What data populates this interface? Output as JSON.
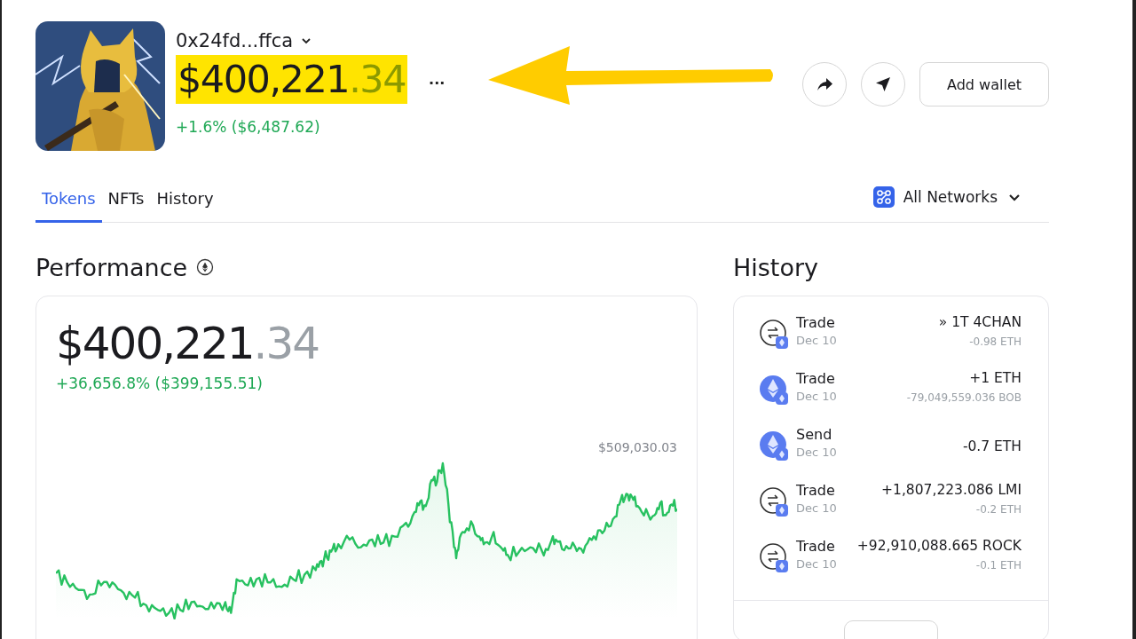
{
  "wallet": {
    "address": "0x24fd...ffca",
    "balance": "$400,221",
    "balance_cents": ".34",
    "highlighted": true,
    "more": "...",
    "change": "+1.6% ($6,487.62)"
  },
  "actions": {
    "add_wallet": "Add wallet"
  },
  "tabs": [
    {
      "label": "Tokens",
      "selected": true
    },
    {
      "label": "NFTs",
      "selected": false
    },
    {
      "label": "History",
      "selected": false
    }
  ],
  "network_filter": {
    "label": "All Networks"
  },
  "performance": {
    "title": "Performance",
    "balance": "$400,221",
    "balance_cents": ".34",
    "change": "+36,656.8% ($399,155.51)",
    "max_label": "$509,030.03"
  },
  "history": {
    "title": "History",
    "items": [
      {
        "kind": "swap",
        "title": "Trade",
        "date": "Dec 10",
        "amount": "» 1T 4CHAN",
        "sub_amount": "-0.98 ETH"
      },
      {
        "kind": "eth",
        "title": "Trade",
        "date": "Dec 10",
        "amount": "+1 ETH",
        "sub_amount": "-79,049,559.036 BOB"
      },
      {
        "kind": "eth",
        "title": "Send",
        "date": "Dec 10",
        "amount": "-0.7 ETH"
      },
      {
        "kind": "swap",
        "title": "Trade",
        "date": "Dec 10",
        "amount": "+1,807,223.086 LMI",
        "sub_amount": "-0.2 ETH"
      },
      {
        "kind": "swap",
        "title": "Trade",
        "date": "Dec 10",
        "amount": "+92,910,088.665 ROCK",
        "sub_amount": "-0.1 ETH"
      }
    ]
  }
}
